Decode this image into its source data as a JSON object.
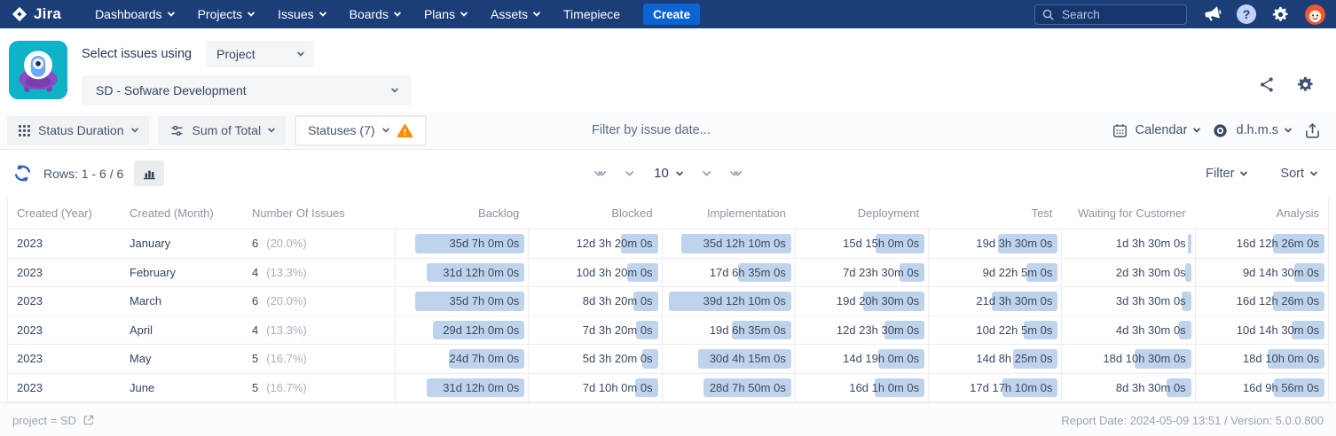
{
  "nav": {
    "brand": "Jira",
    "items": [
      {
        "label": "Dashboards",
        "dropdown": true
      },
      {
        "label": "Projects",
        "dropdown": true
      },
      {
        "label": "Issues",
        "dropdown": true
      },
      {
        "label": "Boards",
        "dropdown": true
      },
      {
        "label": "Plans",
        "dropdown": true
      },
      {
        "label": "Assets",
        "dropdown": true
      },
      {
        "label": "Timepiece",
        "dropdown": false
      }
    ],
    "create_label": "Create",
    "search_placeholder": "Search"
  },
  "report_header": {
    "select_issues_label": "Select issues using",
    "issue_source": "Project",
    "project": "SD - Sofware Development"
  },
  "toolbar": {
    "report_type": "Status Duration",
    "aggregation": "Sum of Total",
    "statuses": "Statuses (7)",
    "date_filter_placeholder": "Filter by issue date...",
    "calendar": "Calendar",
    "time_format": "d.h.m.s"
  },
  "controls": {
    "rows_label": "Rows: 1 - 6 / 6",
    "page_size": "10",
    "filter": "Filter",
    "sort": "Sort"
  },
  "table": {
    "columns": [
      "Created (Year)",
      "Created (Month)",
      "Number Of Issues",
      "Backlog",
      "Blocked",
      "Implementation",
      "Deployment",
      "Test",
      "Waiting for Customer",
      "Analysis"
    ],
    "rows": [
      {
        "year": "2023",
        "month": "January",
        "count": "6",
        "percent": "(20.0%)",
        "durations": [
          "35d 7h 0m 0s",
          "12d 3h 20m 0s",
          "35d 12h 10m 0s",
          "15d 15h 0m 0s",
          "19d 3h 30m 0s",
          "1d 3h 30m 0s",
          "16d 12h 26m 0s"
        ]
      },
      {
        "year": "2023",
        "month": "February",
        "count": "4",
        "percent": "(13.3%)",
        "durations": [
          "31d 12h 0m 0s",
          "10d 3h 20m 0s",
          "17d 6h 35m 0s",
          "7d 23h 30m 0s",
          "9d 22h 5m 0s",
          "2d 3h 30m 0s",
          "9d 14h 30m 0s"
        ]
      },
      {
        "year": "2023",
        "month": "March",
        "count": "6",
        "percent": "(20.0%)",
        "durations": [
          "35d 7h 0m 0s",
          "8d 3h 20m 0s",
          "39d 12h 10m 0s",
          "19d 20h 30m 0s",
          "21d 3h 30m 0s",
          "3d 3h 30m 0s",
          "16d 12h 26m 0s"
        ]
      },
      {
        "year": "2023",
        "month": "April",
        "count": "4",
        "percent": "(13.3%)",
        "durations": [
          "29d 12h 0m 0s",
          "7d 3h 20m 0s",
          "19d 6h 35m 0s",
          "12d 23h 30m 0s",
          "10d 22h 5m 0s",
          "4d 3h 30m 0s",
          "10d 14h 30m 0s"
        ]
      },
      {
        "year": "2023",
        "month": "May",
        "count": "5",
        "percent": "(16.7%)",
        "durations": [
          "24d 7h 0m 0s",
          "5d 3h 20m 0s",
          "30d 4h 15m 0s",
          "14d 19h 0m 0s",
          "14d 8h 25m 0s",
          "18d 10h 30m 0s",
          "18d 10h 0m 0s"
        ]
      },
      {
        "year": "2023",
        "month": "June",
        "count": "5",
        "percent": "(16.7%)",
        "durations": [
          "31d 12h 0m 0s",
          "7d 10h 0m 0s",
          "28d 7h 50m 0s",
          "16d 1h 0m 0s",
          "17d 17h 10m 0s",
          "8d 3h 30m 0s",
          "16d 9h 56m 0s"
        ]
      }
    ]
  },
  "footer": {
    "query": "project = SD",
    "report_info": "Report Date: 2024-05-09 13:51 / Version: 5.0.0.800"
  },
  "colors": {
    "nav_bg": "#1c3e78",
    "create_bg": "#0c63d4",
    "duration_bar": "#bfd4ec",
    "warning": "#ff8b00"
  }
}
